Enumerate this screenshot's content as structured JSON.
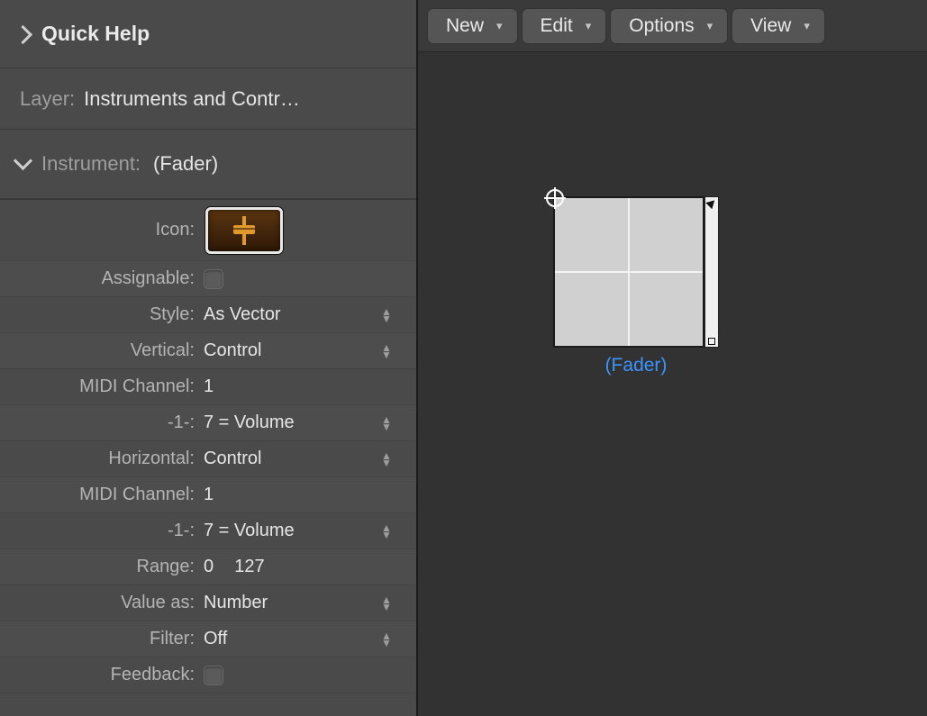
{
  "quickHelp": {
    "title": "Quick Help"
  },
  "layer": {
    "label": "Layer:",
    "value": "Instruments and Contr…"
  },
  "instrument": {
    "label": "Instrument:",
    "value": "(Fader)"
  },
  "props": {
    "icon": {
      "label": "Icon:"
    },
    "assignable": {
      "label": "Assignable:"
    },
    "style": {
      "label": "Style:",
      "value": "As Vector"
    },
    "vertical": {
      "label": "Vertical:",
      "value": "Control"
    },
    "midiCh1": {
      "label": "MIDI Channel:",
      "value": "1"
    },
    "cc1": {
      "label": "-1-:",
      "value": "7 = Volume"
    },
    "horizontal": {
      "label": "Horizontal:",
      "value": "Control"
    },
    "midiCh2": {
      "label": "MIDI Channel:",
      "value": "1"
    },
    "cc2": {
      "label": "-1-:",
      "value": "7 = Volume"
    },
    "range": {
      "label": "Range:",
      "lo": "0",
      "hi": "127"
    },
    "valueAs": {
      "label": "Value as:",
      "value": "Number"
    },
    "filter": {
      "label": "Filter:",
      "value": "Off"
    },
    "feedback": {
      "label": "Feedback:"
    }
  },
  "toolbar": {
    "new": "New",
    "edit": "Edit",
    "options": "Options",
    "view": "View"
  },
  "canvas": {
    "objectLabel": "(Fader)"
  }
}
